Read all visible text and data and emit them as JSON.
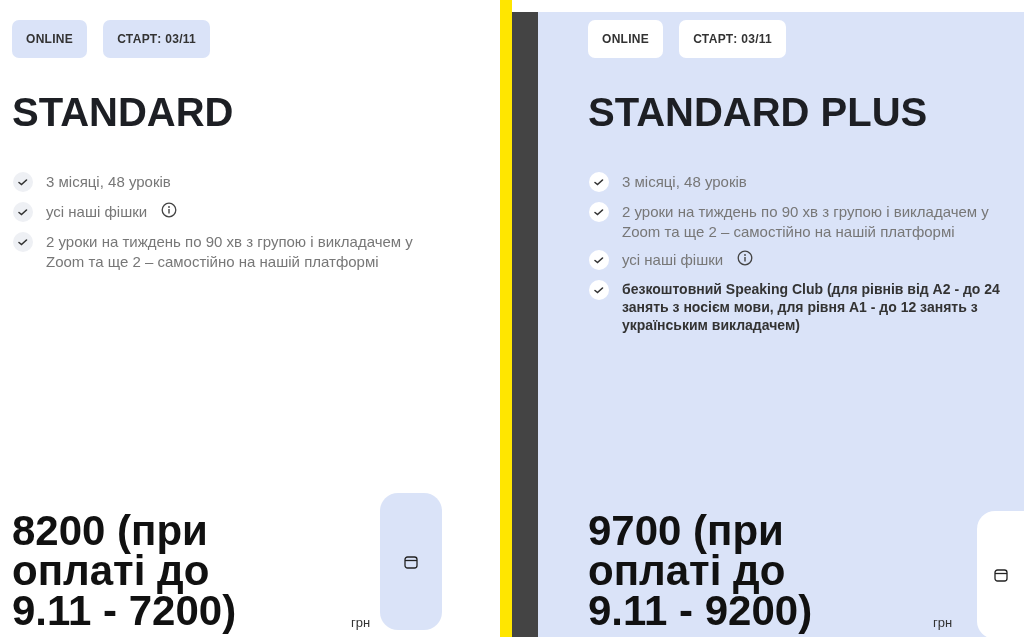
{
  "plans": [
    {
      "highlighted": false,
      "tags": [
        "ONLINE",
        "СТАРТ: 03/11"
      ],
      "title": "STANDARD",
      "features": [
        {
          "text": "3 місяці, 48 уроків",
          "bold": false,
          "info": false
        },
        {
          "text": "усі наші фішки",
          "bold": false,
          "info": true
        },
        {
          "text": "2 уроки на тиждень по 90 хв з групою і викладачем у Zoom та ще 2 – самостійно на нашій платформі",
          "bold": false,
          "info": false
        }
      ],
      "price": "8200 (при оплаті до 9.11 - 7200)",
      "currency": "грн"
    },
    {
      "highlighted": true,
      "tags": [
        "ONLINE",
        "СТАРТ: 03/11"
      ],
      "title": "STANDARD PLUS",
      "features": [
        {
          "text": "3 місяці, 48 уроків",
          "bold": false,
          "info": false
        },
        {
          "text": "2 уроки на тиждень по 90 хв з групою і викладачем у Zoom та ще 2 – самостійно на нашій платформі",
          "bold": false,
          "info": false
        },
        {
          "text": "усі наші фішки",
          "bold": false,
          "info": true
        },
        {
          "text": "безкоштовний Speaking Club (для рівнів від А2 - до 24 занять з носієм мови, для рівня А1 - до 12 занять з українським викладачем)",
          "bold": true,
          "info": false
        }
      ],
      "price": "9700 (при оплаті до 9.11 - 9200)",
      "currency": "грн"
    }
  ]
}
